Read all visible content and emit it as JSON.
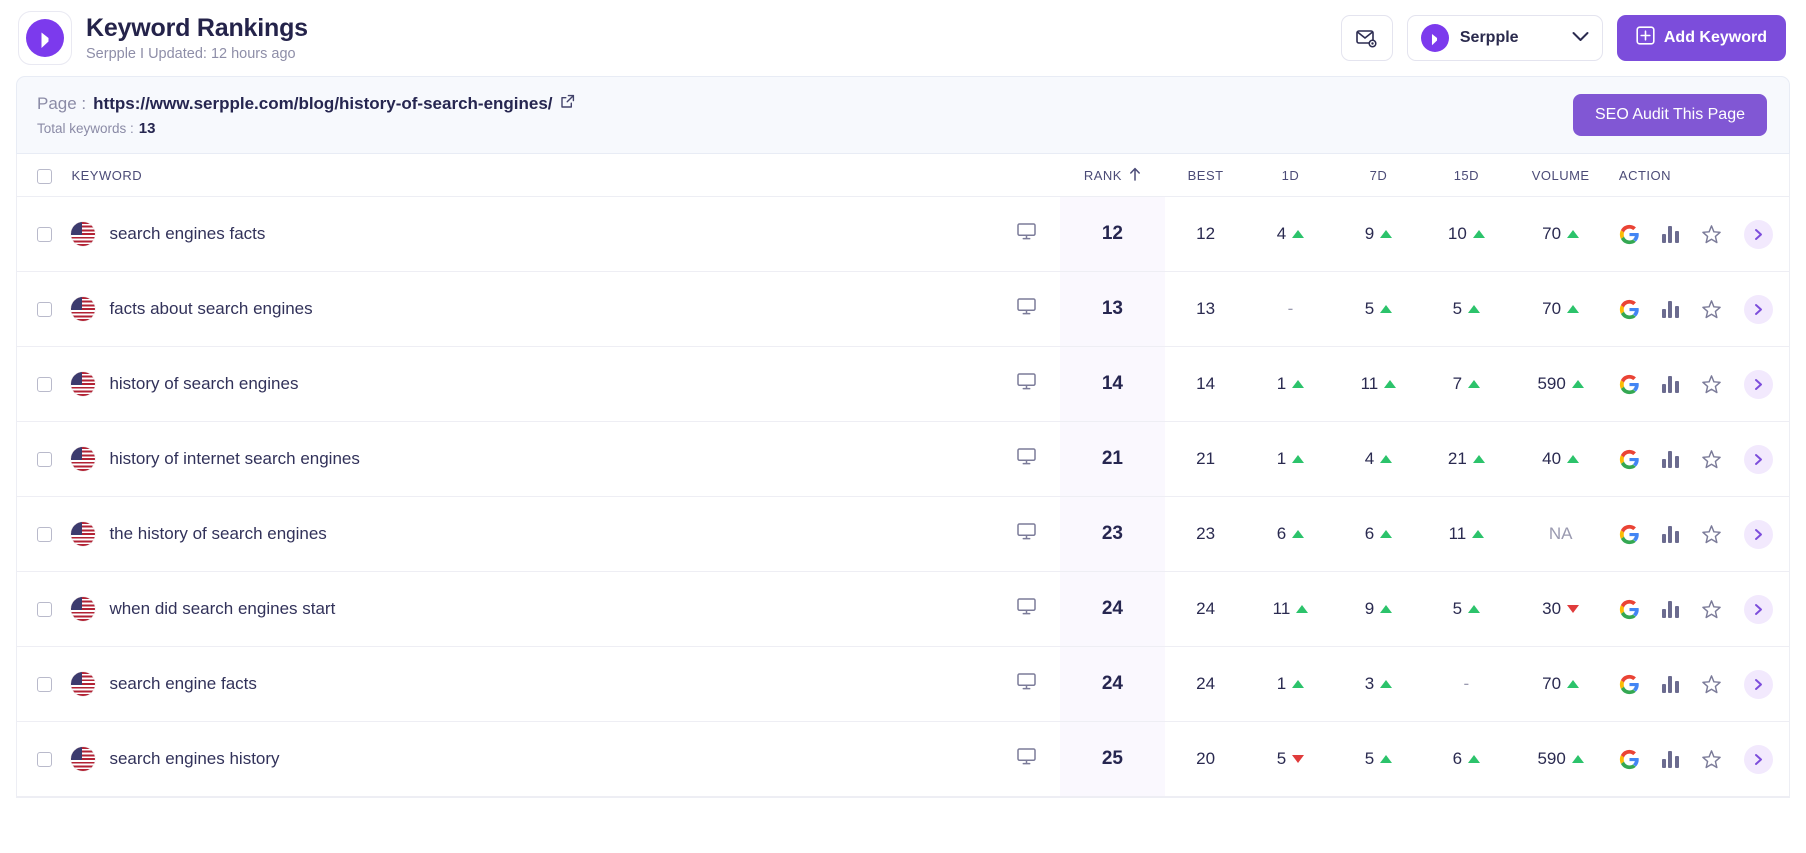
{
  "header": {
    "logo_icon": "serpple-logo-icon",
    "title": "Keyword Rankings",
    "subtitle": "Serpple I Updated: 12 hours ago",
    "email_settings_icon": "email-settings-icon",
    "project": {
      "name": "Serpple",
      "chevron_icon": "chevron-down-icon",
      "logo_icon": "serpple-mini-logo-icon"
    },
    "add_keyword": {
      "label": "Add Keyword",
      "icon": "plus-square-icon"
    },
    "accent_color": "#7c4ddb"
  },
  "url_panel": {
    "page_label": "Page :",
    "page_url": "https://www.serpple.com/blog/history-of-search-engines/",
    "external_link_icon": "external-link-icon",
    "total_keywords_label": "Total keywords :",
    "total_keywords_value": "13",
    "audit_button_label": "SEO Audit This Page",
    "audit_button_color": "#8157d4"
  },
  "table": {
    "columns": [
      {
        "key": "check",
        "label": ""
      },
      {
        "key": "kw",
        "label": "KEYWORD"
      },
      {
        "key": "dev",
        "label": ""
      },
      {
        "key": "rank",
        "label": "RANK",
        "sort_icon": "arrow-up-icon",
        "sorted": true
      },
      {
        "key": "best",
        "label": "BEST"
      },
      {
        "key": "d1",
        "label": "1D"
      },
      {
        "key": "d7",
        "label": "7D"
      },
      {
        "key": "d15",
        "label": "15D"
      },
      {
        "key": "volume",
        "label": "VOLUME"
      },
      {
        "key": "action",
        "label": "ACTION"
      }
    ],
    "select_all_icon": "checkbox-icon",
    "row_icons": {
      "device": "desktop-icon",
      "flag": "us-flag-icon",
      "google": "google-icon",
      "chart": "bar-chart-icon",
      "star": "star-outline-icon",
      "chevron": "chevron-right-icon"
    },
    "rows": [
      {
        "keyword": "search engines facts",
        "country": "US",
        "device": "desktop",
        "rank": "12",
        "best": "12",
        "d1": "4",
        "d1_dir": "up",
        "d7": "9",
        "d7_dir": "up",
        "d15": "10",
        "d15_dir": "up",
        "volume": "70",
        "volume_dir": "up"
      },
      {
        "keyword": "facts about search engines",
        "country": "US",
        "device": "desktop",
        "rank": "13",
        "best": "13",
        "d1": "-",
        "d1_dir": "none",
        "d7": "5",
        "d7_dir": "up",
        "d15": "5",
        "d15_dir": "up",
        "volume": "70",
        "volume_dir": "up"
      },
      {
        "keyword": "history of search engines",
        "country": "US",
        "device": "desktop",
        "rank": "14",
        "best": "14",
        "d1": "1",
        "d1_dir": "up",
        "d7": "11",
        "d7_dir": "up",
        "d15": "7",
        "d15_dir": "up",
        "volume": "590",
        "volume_dir": "up"
      },
      {
        "keyword": "history of internet search engines",
        "country": "US",
        "device": "desktop",
        "rank": "21",
        "best": "21",
        "d1": "1",
        "d1_dir": "up",
        "d7": "4",
        "d7_dir": "up",
        "d15": "21",
        "d15_dir": "up",
        "volume": "40",
        "volume_dir": "up"
      },
      {
        "keyword": "the history of search engines",
        "country": "US",
        "device": "desktop",
        "rank": "23",
        "best": "23",
        "d1": "6",
        "d1_dir": "up",
        "d7": "6",
        "d7_dir": "up",
        "d15": "11",
        "d15_dir": "up",
        "volume": "NA",
        "volume_dir": "none"
      },
      {
        "keyword": "when did search engines start",
        "country": "US",
        "device": "desktop",
        "rank": "24",
        "best": "24",
        "d1": "11",
        "d1_dir": "up",
        "d7": "9",
        "d7_dir": "up",
        "d15": "5",
        "d15_dir": "up",
        "volume": "30",
        "volume_dir": "down"
      },
      {
        "keyword": "search engine facts",
        "country": "US",
        "device": "desktop",
        "rank": "24",
        "best": "24",
        "d1": "1",
        "d1_dir": "up",
        "d7": "3",
        "d7_dir": "up",
        "d15": "-",
        "d15_dir": "none",
        "volume": "70",
        "volume_dir": "up"
      },
      {
        "keyword": "search engines history",
        "country": "US",
        "device": "desktop",
        "rank": "25",
        "best": "20",
        "d1": "5",
        "d1_dir": "down",
        "d7": "5",
        "d7_dir": "up",
        "d15": "6",
        "d15_dir": "up",
        "volume": "590",
        "volume_dir": "up"
      }
    ]
  },
  "colors": {
    "up": "#2cc36b",
    "down": "#e03b3b",
    "rank_cell_bg": "#faf8fe",
    "panel_bg": "#f7f9fd"
  }
}
